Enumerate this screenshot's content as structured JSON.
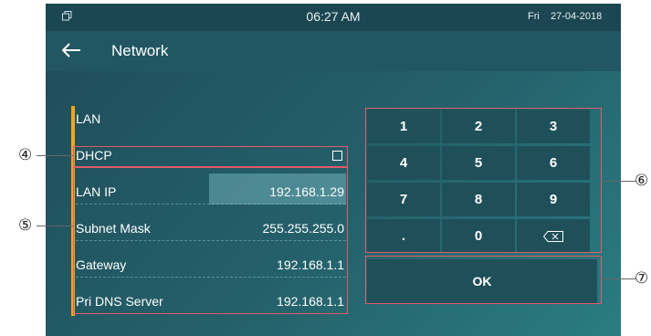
{
  "status_bar": {
    "window_icon": "window-restore-icon",
    "time": "06:27 AM",
    "day": "Fri",
    "date": "27-04-2018"
  },
  "header": {
    "back_icon": "arrow-left-icon",
    "title": "Network"
  },
  "network": {
    "rows": [
      {
        "label": "LAN",
        "value": ""
      },
      {
        "label": "DHCP",
        "value": ""
      },
      {
        "label": "LAN IP",
        "value": "192.168.1.29"
      },
      {
        "label": "Subnet Mask",
        "value": "255.255.255.0"
      },
      {
        "label": "Gateway",
        "value": "192.168.1.1"
      },
      {
        "label": "Pri DNS Server",
        "value": "192.168.1.1"
      }
    ],
    "dhcp_checked": false
  },
  "keypad": {
    "keys": [
      "1",
      "2",
      "3",
      "4",
      "5",
      "6",
      "7",
      "8",
      "9",
      ".",
      "0"
    ],
    "backspace_icon": "backspace-icon",
    "ok_label": "OK"
  },
  "callouts": {
    "c4": "④",
    "c5": "⑤",
    "c6": "⑥",
    "c7": "⑦"
  },
  "colors": {
    "screen_bg": "#24606a",
    "accent": "#f3a51c",
    "annotation": "#e05b6b"
  }
}
